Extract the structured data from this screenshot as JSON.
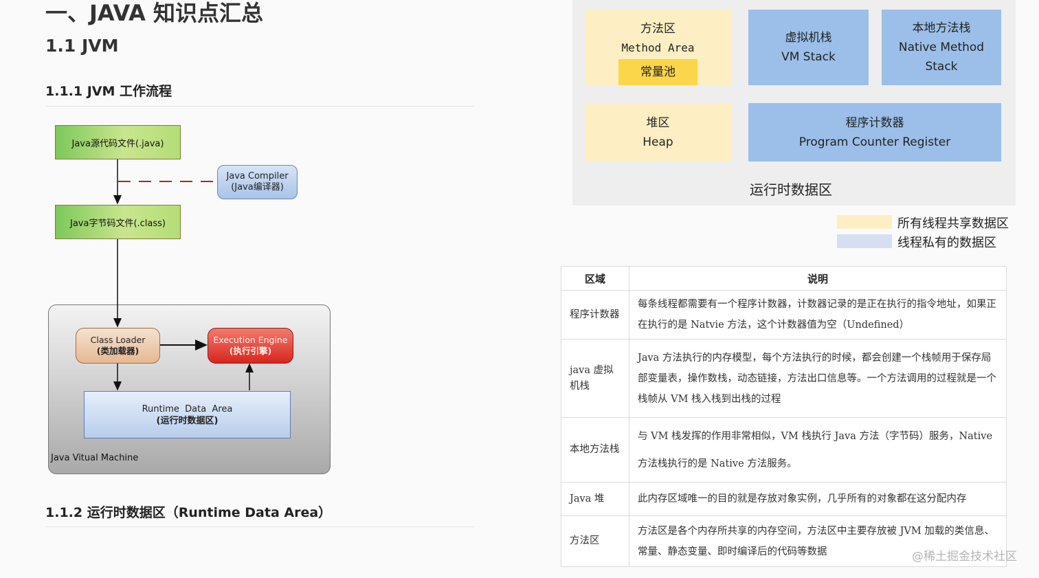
{
  "headings": {
    "h1": "一、JAVA 知识点汇总",
    "h2": "1.1 JVM",
    "h3": "1.1.1 JVM 工作流程",
    "h4": "1.1.2 运行时数据区（Runtime Data Area）"
  },
  "flow": {
    "source_file": "Java源代码文件(.java)",
    "compiler_line1": "Java Compiler",
    "compiler_line2": "(Java编译器)",
    "class_file": "Java字节码文件(.class)",
    "loader_line1": "Class Loader",
    "loader_line2": "(类加载器)",
    "engine_line1": "Execution Engine",
    "engine_line2": "(执行引擎)",
    "rda_line1": "Runtime  Data  Area",
    "rda_line2": "(运行时数据区)",
    "jvm_label": "Java Vitual Machine"
  },
  "runtime_area": {
    "method_cn": "方法区",
    "method_en": "Method Area",
    "pool": "常量池",
    "vmstack_cn": "虚拟机栈",
    "vmstack_en": "VM Stack",
    "native_cn": "本地方法栈",
    "native_en1": "Native Method",
    "native_en2": "Stack",
    "heap_cn": "堆区",
    "heap_en": "Heap",
    "pc_cn": "程序计数器",
    "pc_en": "Program Counter Register",
    "title": "运行时数据区",
    "shared_color": "#fdefc3",
    "private_color": "#9bbfe8"
  },
  "legend": {
    "shared": "所有线程共享数据区",
    "private": "线程私有的数据区"
  },
  "table": {
    "headers": [
      "区域",
      "说明"
    ],
    "rows": [
      {
        "key": "程序计数器",
        "desc": "每条线程都需要有一个程序计数器，计数器记录的是正在执行的指令地址，如果正在执行的是 Natvie 方法，这个计数器值为空（Undefined）"
      },
      {
        "key": "java 虚拟机栈",
        "desc": "Java 方法执行的内存模型，每个方法执行的时候，都会创建一个栈帧用于保存局部变量表，操作数栈，动态链接，方法出口信息等。一个方法调用的过程就是一个栈帧从 VM 栈入栈到出栈的过程"
      },
      {
        "key": "本地方法栈",
        "desc": "与 VM 栈发挥的作用非常相似，VM 栈执行 Java 方法（字节码）服务，Native 方法栈执行的是 Native 方法服务。"
      },
      {
        "key": "Java 堆",
        "desc": "此内存区域唯一的目的就是存放对象实例，几乎所有的对象都在这分配内存"
      },
      {
        "key": "方法区",
        "desc": "方法区是各个内存所共享的内存空间，方法区中主要存放被 JVM 加载的类信息、常量、静态变量、即时编译后的代码等数据"
      }
    ]
  },
  "watermark": "@稀土掘金技术社区"
}
